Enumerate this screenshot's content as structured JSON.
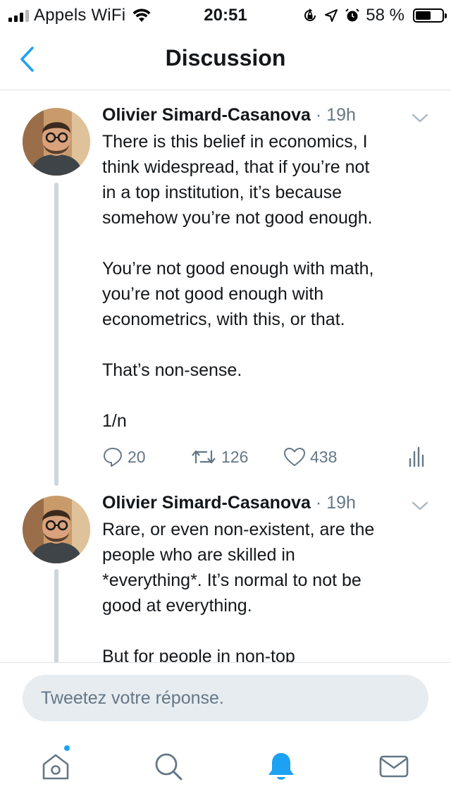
{
  "status_bar": {
    "carrier": "Appels WiFi",
    "time": "20:51",
    "battery_percent": "58 %",
    "battery_level": 0.58
  },
  "nav": {
    "title": "Discussion"
  },
  "colors": {
    "accent": "#1da1f2",
    "text": "#14171a",
    "secondary_text": "#657786",
    "thread_line": "#ccd6dd",
    "input_bg": "#e6ecf0"
  },
  "tweets": [
    {
      "author": "Olivier Simard-Casanova",
      "separator": "·",
      "time": "19h",
      "paragraphs": [
        [
          "There is this belief in economics, I",
          "think widespread, that if you’re not",
          "in a top institution, it’s because",
          "somehow you’re not good enough."
        ],
        [
          "You’re not good enough with math,",
          "you’re not good enough with",
          "econometrics, with this, or that."
        ],
        [
          "That’s non-sense."
        ],
        [
          "1/n"
        ]
      ],
      "replies": "20",
      "retweets": "126",
      "likes": "438"
    },
    {
      "author": "Olivier Simard-Casanova",
      "separator": "·",
      "time": "19h",
      "paragraphs": [
        [
          "Rare, or even non-existent, are the",
          "people who are skilled in",
          "*everything*. It’s normal to not be",
          "good at everything."
        ],
        [
          "But for people in non-top"
        ]
      ]
    }
  ],
  "reply": {
    "placeholder": "Tweetez votre réponse."
  },
  "tab_bar": {
    "items": [
      "home-icon",
      "search-icon",
      "notifications-icon",
      "messages-icon"
    ],
    "active": "notifications-icon"
  }
}
